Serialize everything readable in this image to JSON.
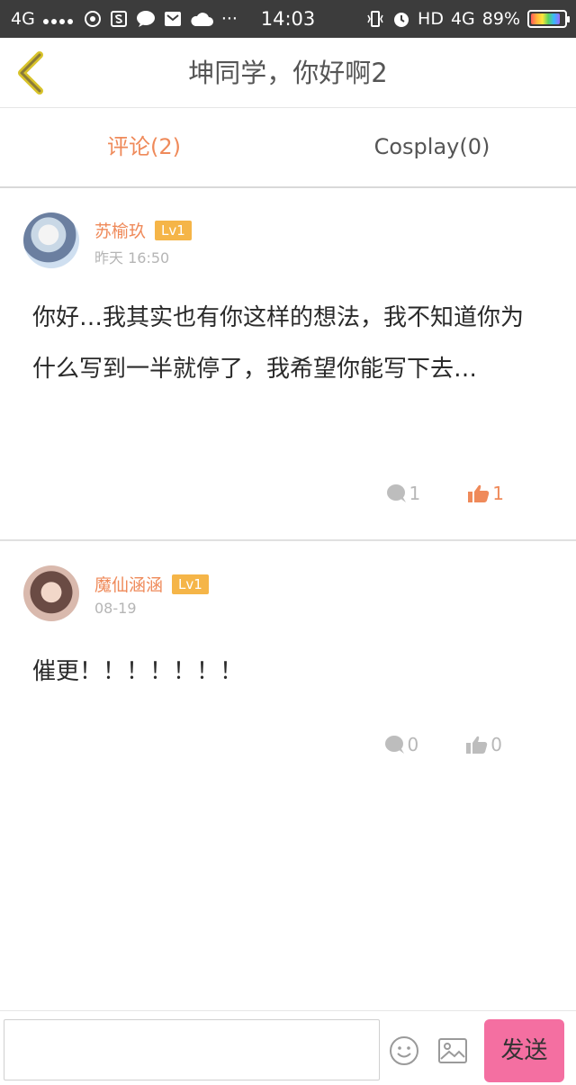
{
  "status_bar": {
    "network": "4G",
    "time": "14:03",
    "hd": "HD",
    "network_right": "4G",
    "battery": "89%",
    "more": "···"
  },
  "header": {
    "title": "坤同学，你好啊2",
    "back_icon": "chevron-left-icon"
  },
  "tabs": [
    {
      "label": "评论(2)",
      "active": true
    },
    {
      "label": "Cosplay(0)",
      "active": false
    }
  ],
  "comments": [
    {
      "username": "苏榆玖",
      "level": "Lv1",
      "time": "昨天 16:50",
      "text": "你好…我其实也有你这样的想法，我不知道你为什么写到一半就停了，我希望你能写下去…",
      "reply_count": "1",
      "like_count": "1",
      "liked": true
    },
    {
      "username": "魔仙涵涵",
      "level": "Lv1",
      "time": "08-19",
      "text": "催更！！！！！！！",
      "reply_count": "0",
      "like_count": "0",
      "liked": false
    }
  ],
  "input_bar": {
    "placeholder": "",
    "send_label": "发送"
  },
  "colors": {
    "accent": "#ef8a5a",
    "level_badge": "#f5b548",
    "send_button": "#f46fa1"
  }
}
